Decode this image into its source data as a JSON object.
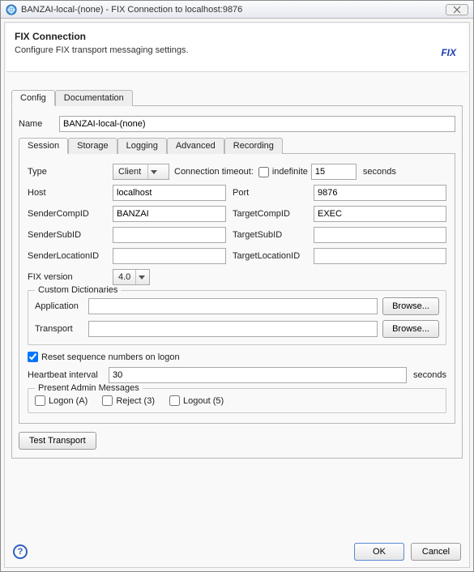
{
  "window": {
    "title": "BANZAI-local-(none) - FIX Connection to localhost:9876"
  },
  "header": {
    "title": "FIX Connection",
    "subtitle": "Configure FIX transport messaging settings.",
    "badge": "FIX"
  },
  "outerTabs": [
    "Config",
    "Documentation"
  ],
  "name": {
    "label": "Name",
    "value": "BANZAI-local-(none)"
  },
  "innerTabs": [
    "Session",
    "Storage",
    "Logging",
    "Advanced",
    "Recording"
  ],
  "session": {
    "typeLabel": "Type",
    "typeValue": "Client",
    "connTimeoutLabel": "Connection timeout:",
    "indefiniteLabel": "indefinite",
    "indefiniteChecked": false,
    "timeoutValue": "15",
    "secondsLabel": "seconds",
    "hostLabel": "Host",
    "hostValue": "localhost",
    "portLabel": "Port",
    "portValue": "9876",
    "senderCompLabel": "SenderCompID",
    "senderCompValue": "BANZAI",
    "targetCompLabel": "TargetCompID",
    "targetCompValue": "EXEC",
    "senderSubLabel": "SenderSubID",
    "senderSubValue": "",
    "targetSubLabel": "TargetSubID",
    "targetSubValue": "",
    "senderLocLabel": "SenderLocationID",
    "senderLocValue": "",
    "targetLocLabel": "TargetLocationID",
    "targetLocValue": "",
    "fixVersionLabel": "FIX version",
    "fixVersionValue": "4.0",
    "customDict": {
      "legend": "Custom Dictionaries",
      "appLabel": "Application",
      "appValue": "",
      "transLabel": "Transport",
      "transValue": "",
      "browseLabel": "Browse..."
    },
    "resetSeqLabel": "Reset sequence numbers on logon",
    "resetSeqChecked": true,
    "heartbeatLabel": "Heartbeat interval",
    "heartbeatValue": "30",
    "admin": {
      "legend": "Present Admin Messages",
      "logonLabel": "Logon (A)",
      "logonChecked": false,
      "rejectLabel": "Reject (3)",
      "rejectChecked": false,
      "logoutLabel": "Logout (5)",
      "logoutChecked": false
    },
    "testTransportLabel": "Test Transport"
  },
  "buttons": {
    "ok": "OK",
    "cancel": "Cancel"
  }
}
